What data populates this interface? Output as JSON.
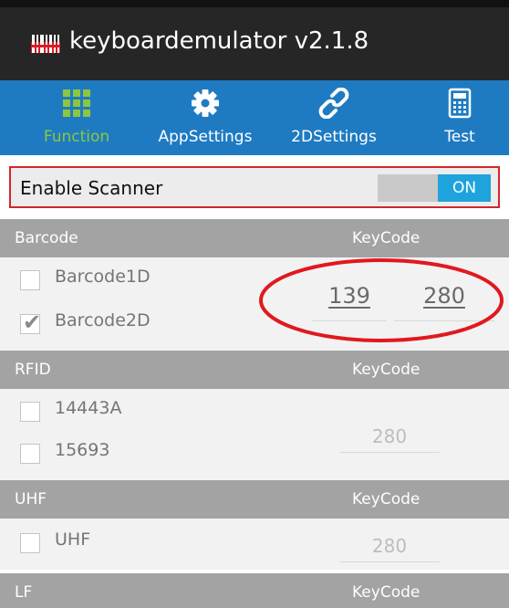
{
  "app": {
    "title": "keyboardemulator v2.1.8",
    "icon": "barcode-scanner-icon"
  },
  "tabs": [
    {
      "label": "Function",
      "icon": "grid-icon",
      "active": true
    },
    {
      "label": "AppSettings",
      "icon": "gear-icon",
      "active": false
    },
    {
      "label": "2DSettings",
      "icon": "link-icon",
      "active": false
    },
    {
      "label": "Test",
      "icon": "calculator-icon",
      "active": false
    }
  ],
  "scanner": {
    "label": "Enable Scanner",
    "toggle_on_label": "ON",
    "enabled": true
  },
  "sections": {
    "barcode": {
      "header": "Barcode",
      "keycode_header": "KeyCode",
      "items": [
        {
          "label": "Barcode1D",
          "checked": false
        },
        {
          "label": "Barcode2D",
          "checked": true
        }
      ],
      "keycodes": [
        "139",
        "280"
      ]
    },
    "rfid": {
      "header": "RFID",
      "keycode_header": "KeyCode",
      "items": [
        {
          "label": "14443A",
          "checked": false
        },
        {
          "label": "15693",
          "checked": false
        }
      ],
      "keycode": "280"
    },
    "uhf": {
      "header": "UHF",
      "keycode_header": "KeyCode",
      "items": [
        {
          "label": "UHF",
          "checked": false
        }
      ],
      "keycode": "280"
    },
    "lf": {
      "header": "LF",
      "keycode_header": "KeyCode"
    }
  },
  "colors": {
    "title_bar": "#262626",
    "tab_bar": "#1e7bc2",
    "active_tab": "#8dc63f",
    "toggle_on": "#1fa3dd",
    "section_header": "#a3a3a3",
    "annotation": "#e0191e"
  },
  "check_mark": "✔"
}
